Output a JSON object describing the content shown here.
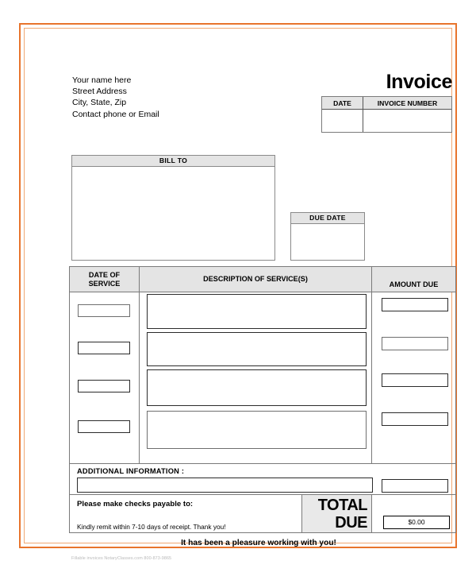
{
  "document": {
    "title": "Invoice",
    "sender": {
      "lines": [
        "Your name here",
        "Street Address",
        "City, State, Zip",
        "Contact phone or Email"
      ]
    },
    "invoice_meta": {
      "date_header": "DATE",
      "number_header": "INVOICE NUMBER",
      "date_value": "",
      "number_value": ""
    },
    "bill_to": {
      "header": "BILL TO",
      "value": ""
    },
    "due_date": {
      "header": "DUE DATE",
      "value": ""
    },
    "services_table": {
      "headers": {
        "date_line1": "DATE OF",
        "date_line2": "SERVICE",
        "description": "DESCRIPTION OF SERVICE(S)",
        "amount": "AMOUNT DUE"
      },
      "rows": [
        {
          "date": "",
          "description": "",
          "amount": ""
        },
        {
          "date": "",
          "description": "",
          "amount": ""
        },
        {
          "date": "",
          "description": "",
          "amount": ""
        },
        {
          "date": "",
          "description": "",
          "amount": ""
        }
      ]
    },
    "additional_information": {
      "label": "ADDITIONAL INFORMATION :",
      "value": "",
      "amount_value": ""
    },
    "payment": {
      "payable_title": "Please make checks payable to:",
      "payable_value": "",
      "remit_note": "Kindly remit within 7-10 days of receipt. Thank you!",
      "total_label_line1": "TOTAL",
      "total_label_line2": "DUE",
      "total_amount": "$0.00"
    },
    "closing_message": "It has been a pleasure working with you!",
    "footer_note": "Fillable invoices NotaryClasses.com 800-873-9865"
  },
  "colors": {
    "frame_outer": "#e8742c",
    "frame_inner": "#f0a873",
    "header_fill": "#e4e4e4",
    "total_fill": "#e9e9e9"
  }
}
